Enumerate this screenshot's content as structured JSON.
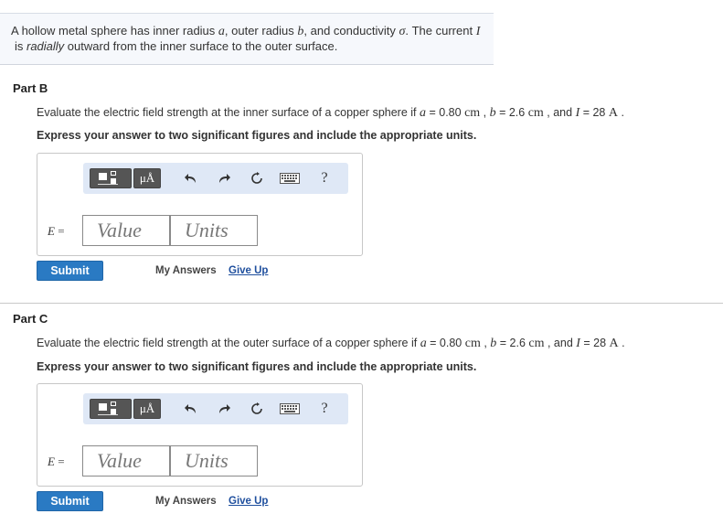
{
  "intro": {
    "line1_a": "A hollow metal sphere has inner radius ",
    "var_a": "a",
    "line1_b": ", outer radius ",
    "var_b": "b",
    "line1_c": ", and conductivity ",
    "var_sigma": "σ",
    "line1_d": ". The current ",
    "var_I": "I",
    "line2_a": "is ",
    "line2_radially": "radially",
    "line2_b": " outward from the inner surface to the outer surface."
  },
  "parts": [
    {
      "title": "Part B",
      "q_a": "Evaluate the electric field strength at the inner surface of a copper sphere if ",
      "var_a": "a",
      "eq_a": " = 0.80 ",
      "unit_cm1": "cm",
      "sep1": " , ",
      "var_b": "b",
      "eq_b": " = 2.6 ",
      "unit_cm2": "cm",
      "sep2": " , and ",
      "var_I": "I",
      "eq_I": " = 28 ",
      "unit_A": "A",
      "end": " .",
      "instruction": "Express your answer to two significant figures and include the appropriate units.",
      "toolbar": {
        "units_symbol": "μÅ",
        "undo": "↶",
        "redo": "↷",
        "reset": "↻",
        "help": "?"
      },
      "eq_var": "E",
      "eq_sign": " =",
      "value_placeholder": "Value",
      "units_placeholder": "Units",
      "submit_label": "Submit",
      "my_answers_label": "My Answers",
      "give_up_label": "Give Up"
    },
    {
      "title": "Part C",
      "q_a": "Evaluate the electric field strength at the outer surface of a copper sphere if ",
      "var_a": "a",
      "eq_a": " = 0.80 ",
      "unit_cm1": "cm",
      "sep1": " , ",
      "var_b": "b",
      "eq_b": " = 2.6 ",
      "unit_cm2": "cm",
      "sep2": " , and ",
      "var_I": "I",
      "eq_I": " = 28 ",
      "unit_A": "A",
      "end": " .",
      "instruction": "Express your answer to two significant figures and include the appropriate units.",
      "toolbar": {
        "units_symbol": "μÅ",
        "undo": "↶",
        "redo": "↷",
        "reset": "↻",
        "help": "?"
      },
      "eq_var": "E",
      "eq_sign": " =",
      "value_placeholder": "Value",
      "units_placeholder": "Units",
      "submit_label": "Submit",
      "my_answers_label": "My Answers",
      "give_up_label": "Give Up"
    }
  ],
  "icons": {
    "templates": "templates-icon",
    "units": "units-icon",
    "undo": "undo-icon",
    "redo": "redo-icon",
    "reset": "reset-icon",
    "keyboard": "keyboard-icon",
    "help": "help-icon"
  },
  "colors": {
    "submit_bg": "#2a7ac3",
    "toolbar_bg": "#dfe8f6",
    "link": "#1f4f9e",
    "intro_bg": "#f6f8fc"
  }
}
